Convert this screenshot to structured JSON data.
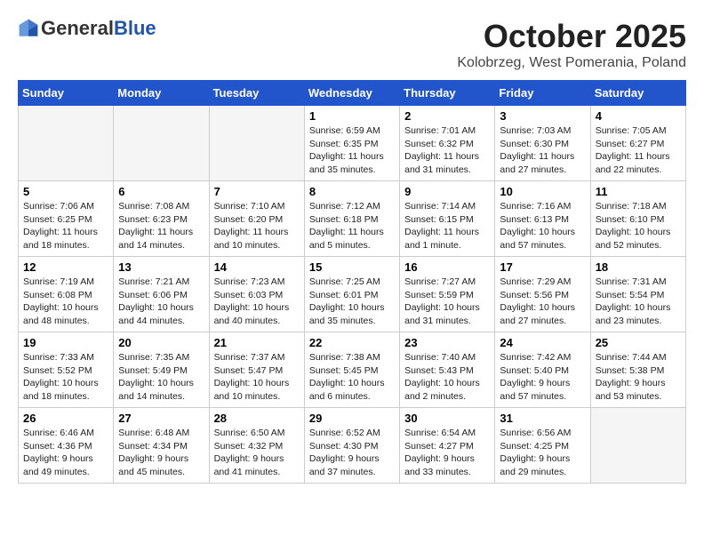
{
  "header": {
    "logo_line1": "General",
    "logo_line2": "Blue",
    "month": "October 2025",
    "location": "Kolobrzeg, West Pomerania, Poland"
  },
  "weekdays": [
    "Sunday",
    "Monday",
    "Tuesday",
    "Wednesday",
    "Thursday",
    "Friday",
    "Saturday"
  ],
  "weeks": [
    [
      {
        "day": "",
        "sunrise": "",
        "sunset": "",
        "daylight": ""
      },
      {
        "day": "",
        "sunrise": "",
        "sunset": "",
        "daylight": ""
      },
      {
        "day": "",
        "sunrise": "",
        "sunset": "",
        "daylight": ""
      },
      {
        "day": "1",
        "sunrise": "Sunrise: 6:59 AM",
        "sunset": "Sunset: 6:35 PM",
        "daylight": "Daylight: 11 hours and 35 minutes."
      },
      {
        "day": "2",
        "sunrise": "Sunrise: 7:01 AM",
        "sunset": "Sunset: 6:32 PM",
        "daylight": "Daylight: 11 hours and 31 minutes."
      },
      {
        "day": "3",
        "sunrise": "Sunrise: 7:03 AM",
        "sunset": "Sunset: 6:30 PM",
        "daylight": "Daylight: 11 hours and 27 minutes."
      },
      {
        "day": "4",
        "sunrise": "Sunrise: 7:05 AM",
        "sunset": "Sunset: 6:27 PM",
        "daylight": "Daylight: 11 hours and 22 minutes."
      }
    ],
    [
      {
        "day": "5",
        "sunrise": "Sunrise: 7:06 AM",
        "sunset": "Sunset: 6:25 PM",
        "daylight": "Daylight: 11 hours and 18 minutes."
      },
      {
        "day": "6",
        "sunrise": "Sunrise: 7:08 AM",
        "sunset": "Sunset: 6:23 PM",
        "daylight": "Daylight: 11 hours and 14 minutes."
      },
      {
        "day": "7",
        "sunrise": "Sunrise: 7:10 AM",
        "sunset": "Sunset: 6:20 PM",
        "daylight": "Daylight: 11 hours and 10 minutes."
      },
      {
        "day": "8",
        "sunrise": "Sunrise: 7:12 AM",
        "sunset": "Sunset: 6:18 PM",
        "daylight": "Daylight: 11 hours and 5 minutes."
      },
      {
        "day": "9",
        "sunrise": "Sunrise: 7:14 AM",
        "sunset": "Sunset: 6:15 PM",
        "daylight": "Daylight: 11 hours and 1 minute."
      },
      {
        "day": "10",
        "sunrise": "Sunrise: 7:16 AM",
        "sunset": "Sunset: 6:13 PM",
        "daylight": "Daylight: 10 hours and 57 minutes."
      },
      {
        "day": "11",
        "sunrise": "Sunrise: 7:18 AM",
        "sunset": "Sunset: 6:10 PM",
        "daylight": "Daylight: 10 hours and 52 minutes."
      }
    ],
    [
      {
        "day": "12",
        "sunrise": "Sunrise: 7:19 AM",
        "sunset": "Sunset: 6:08 PM",
        "daylight": "Daylight: 10 hours and 48 minutes."
      },
      {
        "day": "13",
        "sunrise": "Sunrise: 7:21 AM",
        "sunset": "Sunset: 6:06 PM",
        "daylight": "Daylight: 10 hours and 44 minutes."
      },
      {
        "day": "14",
        "sunrise": "Sunrise: 7:23 AM",
        "sunset": "Sunset: 6:03 PM",
        "daylight": "Daylight: 10 hours and 40 minutes."
      },
      {
        "day": "15",
        "sunrise": "Sunrise: 7:25 AM",
        "sunset": "Sunset: 6:01 PM",
        "daylight": "Daylight: 10 hours and 35 minutes."
      },
      {
        "day": "16",
        "sunrise": "Sunrise: 7:27 AM",
        "sunset": "Sunset: 5:59 PM",
        "daylight": "Daylight: 10 hours and 31 minutes."
      },
      {
        "day": "17",
        "sunrise": "Sunrise: 7:29 AM",
        "sunset": "Sunset: 5:56 PM",
        "daylight": "Daylight: 10 hours and 27 minutes."
      },
      {
        "day": "18",
        "sunrise": "Sunrise: 7:31 AM",
        "sunset": "Sunset: 5:54 PM",
        "daylight": "Daylight: 10 hours and 23 minutes."
      }
    ],
    [
      {
        "day": "19",
        "sunrise": "Sunrise: 7:33 AM",
        "sunset": "Sunset: 5:52 PM",
        "daylight": "Daylight: 10 hours and 18 minutes."
      },
      {
        "day": "20",
        "sunrise": "Sunrise: 7:35 AM",
        "sunset": "Sunset: 5:49 PM",
        "daylight": "Daylight: 10 hours and 14 minutes."
      },
      {
        "day": "21",
        "sunrise": "Sunrise: 7:37 AM",
        "sunset": "Sunset: 5:47 PM",
        "daylight": "Daylight: 10 hours and 10 minutes."
      },
      {
        "day": "22",
        "sunrise": "Sunrise: 7:38 AM",
        "sunset": "Sunset: 5:45 PM",
        "daylight": "Daylight: 10 hours and 6 minutes."
      },
      {
        "day": "23",
        "sunrise": "Sunrise: 7:40 AM",
        "sunset": "Sunset: 5:43 PM",
        "daylight": "Daylight: 10 hours and 2 minutes."
      },
      {
        "day": "24",
        "sunrise": "Sunrise: 7:42 AM",
        "sunset": "Sunset: 5:40 PM",
        "daylight": "Daylight: 9 hours and 57 minutes."
      },
      {
        "day": "25",
        "sunrise": "Sunrise: 7:44 AM",
        "sunset": "Sunset: 5:38 PM",
        "daylight": "Daylight: 9 hours and 53 minutes."
      }
    ],
    [
      {
        "day": "26",
        "sunrise": "Sunrise: 6:46 AM",
        "sunset": "Sunset: 4:36 PM",
        "daylight": "Daylight: 9 hours and 49 minutes."
      },
      {
        "day": "27",
        "sunrise": "Sunrise: 6:48 AM",
        "sunset": "Sunset: 4:34 PM",
        "daylight": "Daylight: 9 hours and 45 minutes."
      },
      {
        "day": "28",
        "sunrise": "Sunrise: 6:50 AM",
        "sunset": "Sunset: 4:32 PM",
        "daylight": "Daylight: 9 hours and 41 minutes."
      },
      {
        "day": "29",
        "sunrise": "Sunrise: 6:52 AM",
        "sunset": "Sunset: 4:30 PM",
        "daylight": "Daylight: 9 hours and 37 minutes."
      },
      {
        "day": "30",
        "sunrise": "Sunrise: 6:54 AM",
        "sunset": "Sunset: 4:27 PM",
        "daylight": "Daylight: 9 hours and 33 minutes."
      },
      {
        "day": "31",
        "sunrise": "Sunrise: 6:56 AM",
        "sunset": "Sunset: 4:25 PM",
        "daylight": "Daylight: 9 hours and 29 minutes."
      },
      {
        "day": "",
        "sunrise": "",
        "sunset": "",
        "daylight": ""
      }
    ]
  ]
}
